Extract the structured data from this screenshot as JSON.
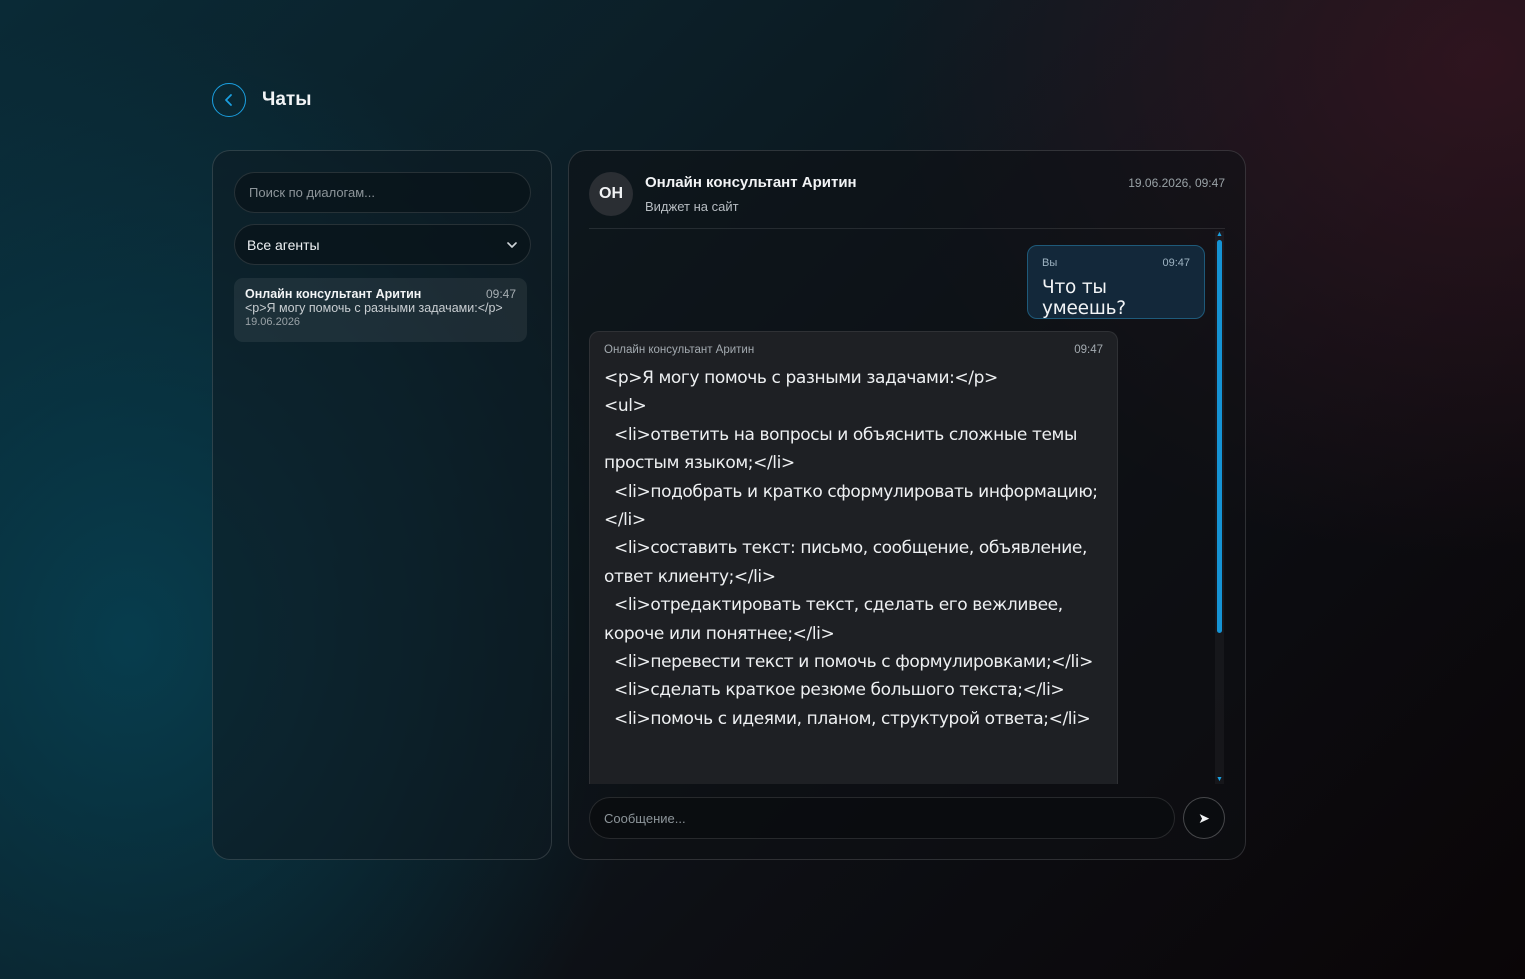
{
  "header": {
    "title": "Чаты",
    "back_icon": "chevron-left-icon"
  },
  "sidebar": {
    "search_placeholder": "Поиск по диалогам...",
    "agent_filter": "Все агенты",
    "dialogs": [
      {
        "name": "Онлайн консультант Аритин",
        "time": "09:47",
        "preview": "<p>Я могу помочь с разными задачами:</p>",
        "date": "19.06.2026"
      }
    ]
  },
  "chat": {
    "avatar_initials": "ОН",
    "name": "Онлайн консультант Аритин",
    "subtitle": "Виджет на сайт",
    "datetime": "19.06.2026, 09:47",
    "messages": {
      "user": {
        "author": "Вы",
        "time": "09:47",
        "text": "Что ты умеешь?"
      },
      "bot": {
        "author": "Онлайн консультант Аритин",
        "time": "09:47",
        "text": "<p>Я могу помочь с разными задачами:</p>\n<ul>\n  <li>ответить на вопросы и объяснить сложные темы простым языком;</li>\n  <li>подобрать и кратко сформулировать информацию;</li>\n  <li>составить текст: письмо, сообщение, объявление, ответ клиенту;</li>\n  <li>отредактировать текст, сделать его вежливее, короче или понятнее;</li>\n  <li>перевести текст и помочь с формулировками;</li>\n  <li>сделать краткое резюме большого текста;</li>\n  <li>помочь с идеями, планом, структурой ответа;</li>"
      }
    },
    "composer_placeholder": "Сообщение...",
    "send_icon": "send-arrow-icon"
  },
  "colors": {
    "accent": "#1a9fe0",
    "user_bubble": "#13283a",
    "bot_bubble": "#1e2024"
  }
}
